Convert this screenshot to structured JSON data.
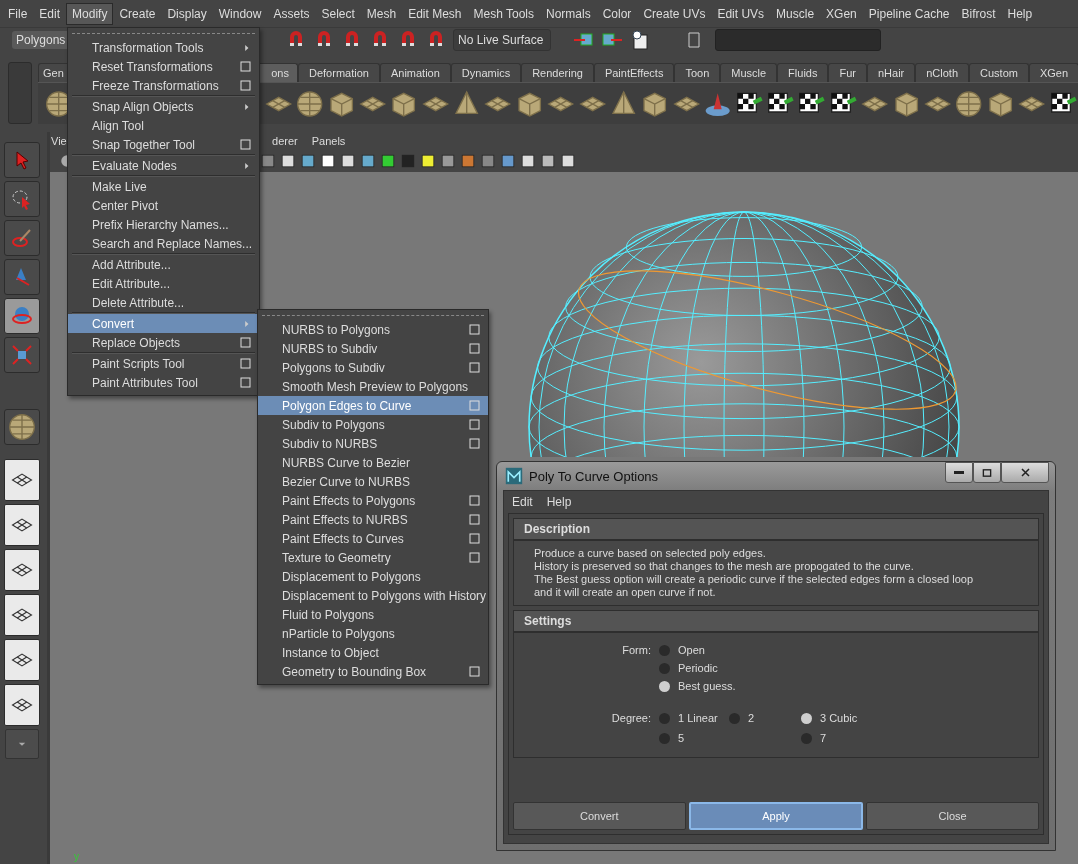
{
  "menu_bar": [
    {
      "label": "File",
      "selected": false
    },
    {
      "label": "Edit",
      "selected": false
    },
    {
      "label": "Modify",
      "selected": true
    },
    {
      "label": "Create",
      "selected": false
    },
    {
      "label": "Display",
      "selected": false
    },
    {
      "label": "Window",
      "selected": false
    },
    {
      "label": "Assets",
      "selected": false
    },
    {
      "label": "Select",
      "selected": false
    },
    {
      "label": "Mesh",
      "selected": false
    },
    {
      "label": "Edit Mesh",
      "selected": false
    },
    {
      "label": "Mesh Tools",
      "selected": false
    },
    {
      "label": "Normals",
      "selected": false
    },
    {
      "label": "Color",
      "selected": false
    },
    {
      "label": "Create UVs",
      "selected": false
    },
    {
      "label": "Edit UVs",
      "selected": false
    },
    {
      "label": "Muscle",
      "selected": false
    },
    {
      "label": "XGen",
      "selected": false
    },
    {
      "label": "Pipeline Cache",
      "selected": false
    },
    {
      "label": "Bifrost",
      "selected": false
    },
    {
      "label": "Help",
      "selected": false
    }
  ],
  "status_line": {
    "mode": "Polygons",
    "live_surface": "No Live Surface"
  },
  "shelf_tabs": [
    {
      "label": "Gen",
      "selected": false
    },
    {
      "label": "ons",
      "selected": true
    },
    {
      "label": "Deformation",
      "selected": false
    },
    {
      "label": "Animation",
      "selected": false
    },
    {
      "label": "Dynamics",
      "selected": false
    },
    {
      "label": "Rendering",
      "selected": false
    },
    {
      "label": "PaintEffects",
      "selected": false
    },
    {
      "label": "Toon",
      "selected": false
    },
    {
      "label": "Muscle",
      "selected": false
    },
    {
      "label": "Fluids",
      "selected": false
    },
    {
      "label": "Fur",
      "selected": false
    },
    {
      "label": "nHair",
      "selected": false
    },
    {
      "label": "nCloth",
      "selected": false
    },
    {
      "label": "Custom",
      "selected": false
    },
    {
      "label": "XGen",
      "selected": false
    }
  ],
  "toolbox": {
    "tools": [
      {
        "kind": "select",
        "selected": false
      },
      {
        "kind": "lasso",
        "selected": false
      },
      {
        "kind": "paint",
        "selected": false
      },
      {
        "kind": "move",
        "selected": false
      },
      {
        "kind": "rotate",
        "selected": true
      },
      {
        "kind": "scale",
        "selected": false
      }
    ]
  },
  "viewport": {
    "menus": [
      "Vie",
      "derer",
      "Panels"
    ],
    "axis_label": "y"
  },
  "modify_menu": {
    "groups": [
      [
        {
          "label": "Transformation Tools",
          "kind": "submenu",
          "selected": false
        },
        {
          "label": "Reset Transformations",
          "kind": "option",
          "selected": false
        },
        {
          "label": "Freeze Transformations",
          "kind": "option",
          "selected": false
        }
      ],
      [
        {
          "label": "Snap Align Objects",
          "kind": "submenu",
          "selected": false
        },
        {
          "label": "Align Tool",
          "kind": "plain",
          "selected": false
        },
        {
          "label": "Snap Together Tool",
          "kind": "option",
          "selected": false
        }
      ],
      [
        {
          "label": "Evaluate Nodes",
          "kind": "submenu",
          "selected": false
        }
      ],
      [
        {
          "label": "Make Live",
          "kind": "plain",
          "selected": false
        },
        {
          "label": "Center Pivot",
          "kind": "plain",
          "selected": false
        },
        {
          "label": "Prefix Hierarchy Names...",
          "kind": "plain",
          "selected": false
        },
        {
          "label": "Search and Replace Names...",
          "kind": "plain",
          "selected": false
        }
      ],
      [
        {
          "label": "Add Attribute...",
          "kind": "plain",
          "selected": false
        },
        {
          "label": "Edit Attribute...",
          "kind": "plain",
          "selected": false
        },
        {
          "label": "Delete Attribute...",
          "kind": "plain",
          "selected": false
        }
      ],
      [
        {
          "label": "Convert",
          "kind": "submenu",
          "selected": true
        },
        {
          "label": "Replace Objects",
          "kind": "option",
          "selected": false
        }
      ],
      [
        {
          "label": "Paint Scripts Tool",
          "kind": "option",
          "selected": false
        },
        {
          "label": "Paint Attributes Tool",
          "kind": "option",
          "selected": false
        }
      ]
    ]
  },
  "convert_submenu": {
    "items": [
      {
        "label": "NURBS to Polygons",
        "kind": "option",
        "selected": false
      },
      {
        "label": "NURBS to Subdiv",
        "kind": "option",
        "selected": false
      },
      {
        "label": "Polygons to Subdiv",
        "kind": "option",
        "selected": false
      },
      {
        "label": "Smooth Mesh Preview to Polygons",
        "kind": "plain",
        "selected": false
      },
      {
        "label": "Polygon Edges to Curve",
        "kind": "option",
        "selected": true
      },
      {
        "label": "Subdiv to Polygons",
        "kind": "option",
        "selected": false
      },
      {
        "label": "Subdiv to NURBS",
        "kind": "option",
        "selected": false
      },
      {
        "label": "NURBS Curve to Bezier",
        "kind": "plain",
        "selected": false
      },
      {
        "label": "Bezier Curve to NURBS",
        "kind": "plain",
        "selected": false
      },
      {
        "label": "Paint Effects to Polygons",
        "kind": "option",
        "selected": false
      },
      {
        "label": "Paint Effects to NURBS",
        "kind": "option",
        "selected": false
      },
      {
        "label": "Paint Effects to Curves",
        "kind": "option",
        "selected": false
      },
      {
        "label": "Texture to Geometry",
        "kind": "option",
        "selected": false
      },
      {
        "label": "Displacement to Polygons",
        "kind": "plain",
        "selected": false
      },
      {
        "label": "Displacement to Polygons with History",
        "kind": "plain",
        "selected": false
      },
      {
        "label": "Fluid to Polygons",
        "kind": "plain",
        "selected": false
      },
      {
        "label": "nParticle to Polygons",
        "kind": "plain",
        "selected": false
      },
      {
        "label": "Instance to Object",
        "kind": "plain",
        "selected": false
      },
      {
        "label": "Geometry to Bounding Box",
        "kind": "option",
        "selected": false
      }
    ]
  },
  "dialog": {
    "title": "Poly To Curve Options",
    "menus": [
      "Edit",
      "Help"
    ],
    "description": {
      "title": "Description",
      "lines": [
        "Produce a curve based on selected poly edges.",
        "History is preserved so that changes to the mesh are propogated to the curve.",
        "The Best guess option will create a periodic curve if the selected edges form a closed loop",
        "and it will create an open curve if not."
      ]
    },
    "settings": {
      "title": "Settings",
      "form": {
        "label": "Form:",
        "options": [
          {
            "label": "Open",
            "selected": false
          },
          {
            "label": "Periodic",
            "selected": false
          },
          {
            "label": "Best guess.",
            "selected": true
          }
        ]
      },
      "degree": {
        "label": "Degree:",
        "options": [
          {
            "label": "1 Linear",
            "selected": false
          },
          {
            "label": "2",
            "selected": false
          },
          {
            "label": "3 Cubic",
            "selected": true
          },
          {
            "label": "5",
            "selected": false
          },
          {
            "label": "7",
            "selected": false
          }
        ]
      }
    },
    "buttons": [
      {
        "label": "Convert",
        "selected": false
      },
      {
        "label": "Apply",
        "selected": true
      },
      {
        "label": "Close",
        "selected": false
      }
    ]
  }
}
